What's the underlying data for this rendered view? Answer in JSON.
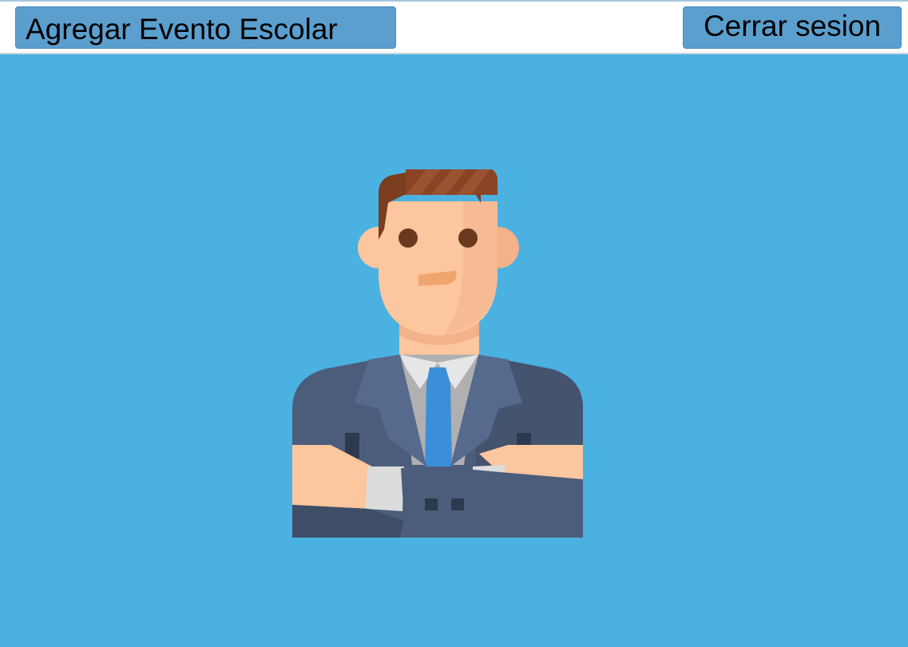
{
  "header": {
    "add_event_label": "Agregar Evento Escolar",
    "logout_label": "Cerrar sesion"
  },
  "main": {
    "avatar_icon": "businessman-avatar-icon"
  },
  "colors": {
    "background": "#4ab1e0",
    "button": "#5b9fcf",
    "topbar": "#ffffff"
  }
}
